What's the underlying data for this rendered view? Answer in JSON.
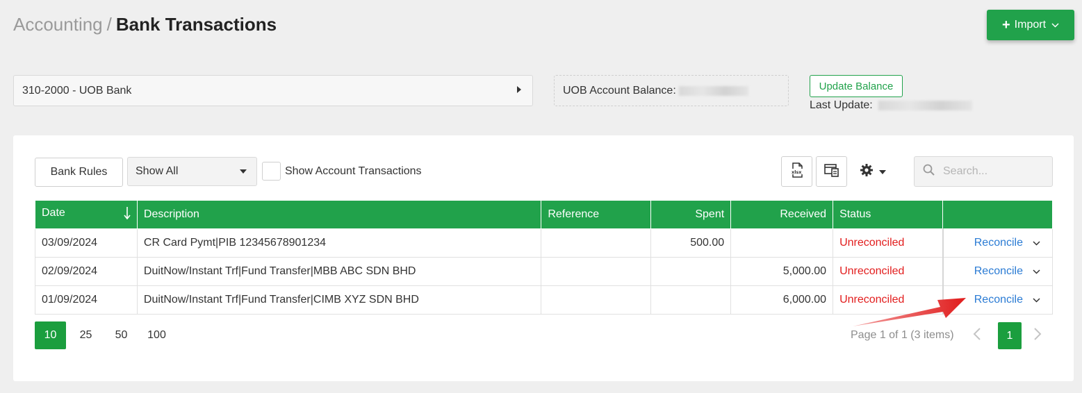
{
  "breadcrumb": {
    "parent": "Accounting",
    "separator": "/",
    "current": "Bank Transactions"
  },
  "import_button": {
    "label": "Import"
  },
  "bank_account": {
    "selected": "310-2000 - UOB Bank"
  },
  "balance": {
    "label": "UOB Account Balance:"
  },
  "update_balance": {
    "label": "Update Balance",
    "last_update_label": "Last Update:"
  },
  "toolbar": {
    "bank_rules": "Bank Rules",
    "filter_selected": "Show All",
    "show_account_transactions": "Show Account Transactions",
    "search_placeholder": "Search..."
  },
  "table": {
    "columns": [
      "Date",
      "Description",
      "Reference",
      "Spent",
      "Received",
      "Status",
      ""
    ],
    "rows": [
      {
        "date": "03/09/2024",
        "description": "CR Card Pymt|PIB 12345678901234",
        "reference": "",
        "spent": "500.00",
        "received": "",
        "status": "Unreconciled",
        "action": "Reconcile"
      },
      {
        "date": "02/09/2024",
        "description": "DuitNow/Instant Trf|Fund Transfer|MBB ABC SDN BHD",
        "reference": "",
        "spent": "",
        "received": "5,000.00",
        "status": "Unreconciled",
        "action": "Reconcile"
      },
      {
        "date": "01/09/2024",
        "description": "DuitNow/Instant Trf|Fund Transfer|CIMB XYZ SDN BHD",
        "reference": "",
        "spent": "",
        "received": "6,000.00",
        "status": "Unreconciled",
        "action": "Reconcile"
      }
    ]
  },
  "pagination": {
    "page_sizes": [
      "10",
      "25",
      "50",
      "100"
    ],
    "active_size": "10",
    "info": "Page 1 of 1 (3 items)",
    "current_page": "1"
  },
  "colors": {
    "primary": "#21a24b",
    "status_unreconciled": "#e21d1d",
    "link": "#2a7bd4",
    "annotation_arrow": "#e01b1b"
  }
}
